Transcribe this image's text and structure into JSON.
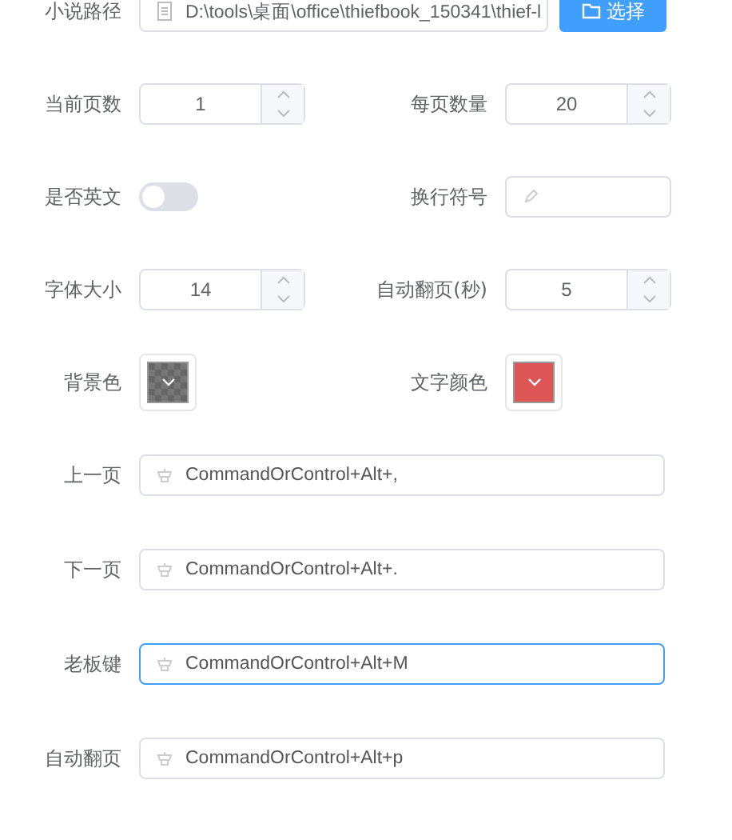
{
  "path": {
    "label": "小说路径",
    "value": "D:\\tools\\桌面\\office\\thiefbook_150341\\thief-l",
    "button": "选择"
  },
  "grid": [
    {
      "kind": "number",
      "label": "当前页数",
      "value": "1"
    },
    {
      "kind": "number",
      "label": "每页数量",
      "value": "20"
    },
    {
      "kind": "switch",
      "label": "是否英文",
      "on": false
    },
    {
      "kind": "text",
      "label": "换行符号"
    },
    {
      "kind": "number",
      "label": "字体大小",
      "value": "14"
    },
    {
      "kind": "number",
      "label": "自动翻页(秒)",
      "value": "5"
    },
    {
      "kind": "color",
      "label": "背景色"
    },
    {
      "kind": "color",
      "label": "文字颜色",
      "color": "#dd5555"
    }
  ],
  "shortcuts": [
    {
      "label": "上一页",
      "value": "CommandOrControl+Alt+,",
      "focused": false
    },
    {
      "label": "下一页",
      "value": "CommandOrControl+Alt+.",
      "focused": false
    },
    {
      "label": "老板键",
      "value": "CommandOrControl+Alt+M",
      "focused": true
    },
    {
      "label": "自动翻页",
      "value": "CommandOrControl+Alt+p",
      "focused": false
    }
  ]
}
